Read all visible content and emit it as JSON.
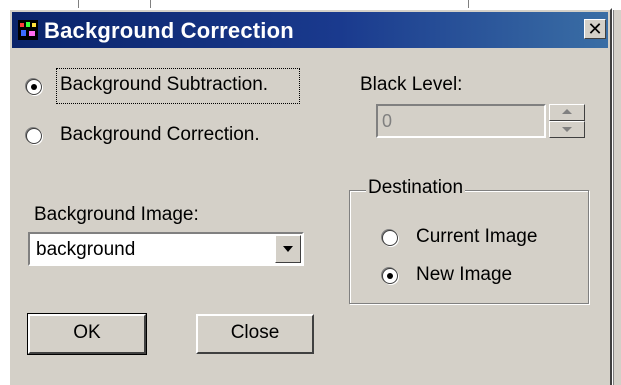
{
  "dialog": {
    "title": "Background Correction",
    "close_label": "✕"
  },
  "mode": {
    "options": [
      {
        "label": "Background Subtraction.",
        "selected": true
      },
      {
        "label": "Background Correction.",
        "selected": false
      }
    ]
  },
  "black_level": {
    "label": "Black Level:",
    "value": "0",
    "enabled": false
  },
  "background_image": {
    "label": "Background Image:",
    "selected": "background"
  },
  "destination": {
    "legend": "Destination",
    "options": [
      {
        "label": "Current Image",
        "selected": false
      },
      {
        "label": "New Image",
        "selected": true
      }
    ]
  },
  "buttons": {
    "ok": "OK",
    "close": "Close"
  },
  "colors": {
    "titlebar_start": "#0a246a",
    "titlebar_end": "#3a6ea5",
    "face": "#d4d0c8"
  },
  "icons": [
    "app-icon",
    "close-icon",
    "spin-up-icon",
    "spin-down-icon",
    "dropdown-arrow-icon"
  ]
}
